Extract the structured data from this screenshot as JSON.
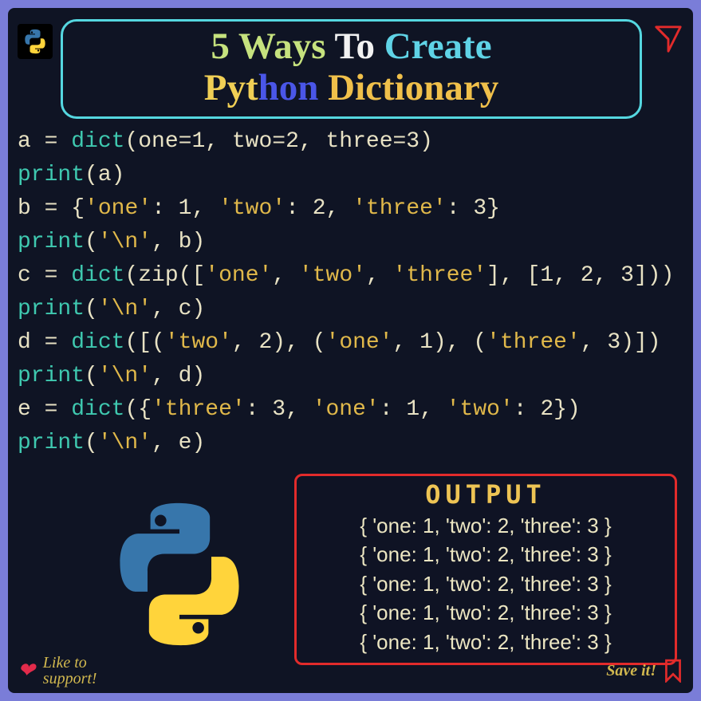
{
  "title": {
    "w1": "5 Ways",
    "w2": "To",
    "w3": "Create",
    "w4a": "Pyt",
    "w4b": "hon",
    "w5": "Dictionary"
  },
  "code": {
    "l1": {
      "a": "a",
      "eq": " = ",
      "fn": "dict",
      "args": "(one=1, two=2, three=3)"
    },
    "l2": {
      "fn": "print",
      "args": "(a)"
    },
    "l3": {
      "a": "b",
      "eq": " = ",
      "body_open": "{",
      "s1": "'one'",
      "c1": ": 1, ",
      "s2": "'two'",
      "c2": ": 2, ",
      "s3": "'three'",
      "c3": ": 3",
      "body_close": "}"
    },
    "l4": {
      "fn": "print",
      "open": "(",
      "s": "'\\n'",
      "rest": ", b)"
    },
    "l5": {
      "a": "c",
      "eq": " = ",
      "fn": "dict",
      "open": "(zip([",
      "s1": "'one'",
      "c1": ", ",
      "s2": "'two'",
      "c2": ", ",
      "s3": "'three'",
      "mid": "], [1, 2, 3]))"
    },
    "l6": {
      "fn": "print",
      "open": "(",
      "s": "'\\n'",
      "rest": ", c)"
    },
    "l7": {
      "a": "d",
      "eq": " = ",
      "fn": "dict",
      "open": "([(",
      "s1": "'two'",
      "c1": ", 2), (",
      "s2": "'one'",
      "c2": ", 1), (",
      "s3": "'three'",
      "c3": ", 3)])"
    },
    "l8": {
      "fn": "print",
      "open": "(",
      "s": "'\\n'",
      "rest": ", d)"
    },
    "l9": {
      "a": "e",
      "eq": " = ",
      "fn": "dict",
      "open": "({",
      "s1": "'three'",
      "c1": ": 3, ",
      "s2": "'one'",
      "c2": ": 1, ",
      "s3": "'two'",
      "c3": ": 2})"
    },
    "l10": {
      "fn": "print",
      "open": "(",
      "s": "'\\n'",
      "rest": ", e)"
    }
  },
  "output": {
    "title": "OUTPUT",
    "lines": [
      "{ 'one: 1, 'two': 2, 'three': 3 }",
      "{ 'one: 1, 'two': 2, 'three': 3 }",
      "{ 'one: 1, 'two': 2, 'three': 3 }",
      "{ 'one: 1, 'two': 2, 'three': 3 }",
      "{ 'one: 1, 'two': 2, 'three': 3 }"
    ]
  },
  "footer": {
    "like1": "Like to",
    "like2": "support!",
    "save": "Save it!"
  }
}
